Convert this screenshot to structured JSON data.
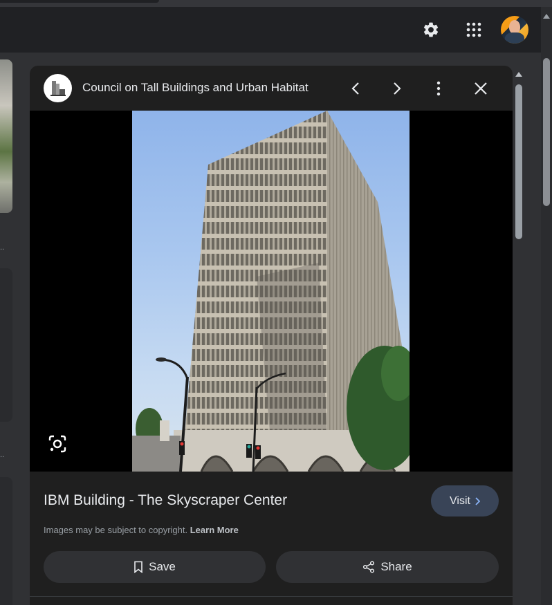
{
  "panel": {
    "site_name": "Council on Tall Buildings and Urban Habitat",
    "result_title": "IBM Building - The Skyscraper Center",
    "visit_label": "Visit",
    "copyright_text": "Images may be subject to copyright.",
    "learn_more_label": "Learn More",
    "save_label": "Save",
    "share_label": "Share"
  },
  "left_column": {
    "ellipsis_1": "..",
    "ellipsis_2": ".."
  },
  "icons": {
    "settings": "gear-icon",
    "apps": "apps-grid-icon",
    "previous": "chevron-left-icon",
    "next": "chevron-right-icon",
    "more": "more-vert-icon",
    "close": "close-icon",
    "lens": "google-lens-icon",
    "save": "bookmark-icon",
    "share": "share-icon"
  },
  "colors": {
    "background": "#202124",
    "panel": "#1f1f1f",
    "visit_button": "#394457",
    "pill_button": "#303134"
  }
}
